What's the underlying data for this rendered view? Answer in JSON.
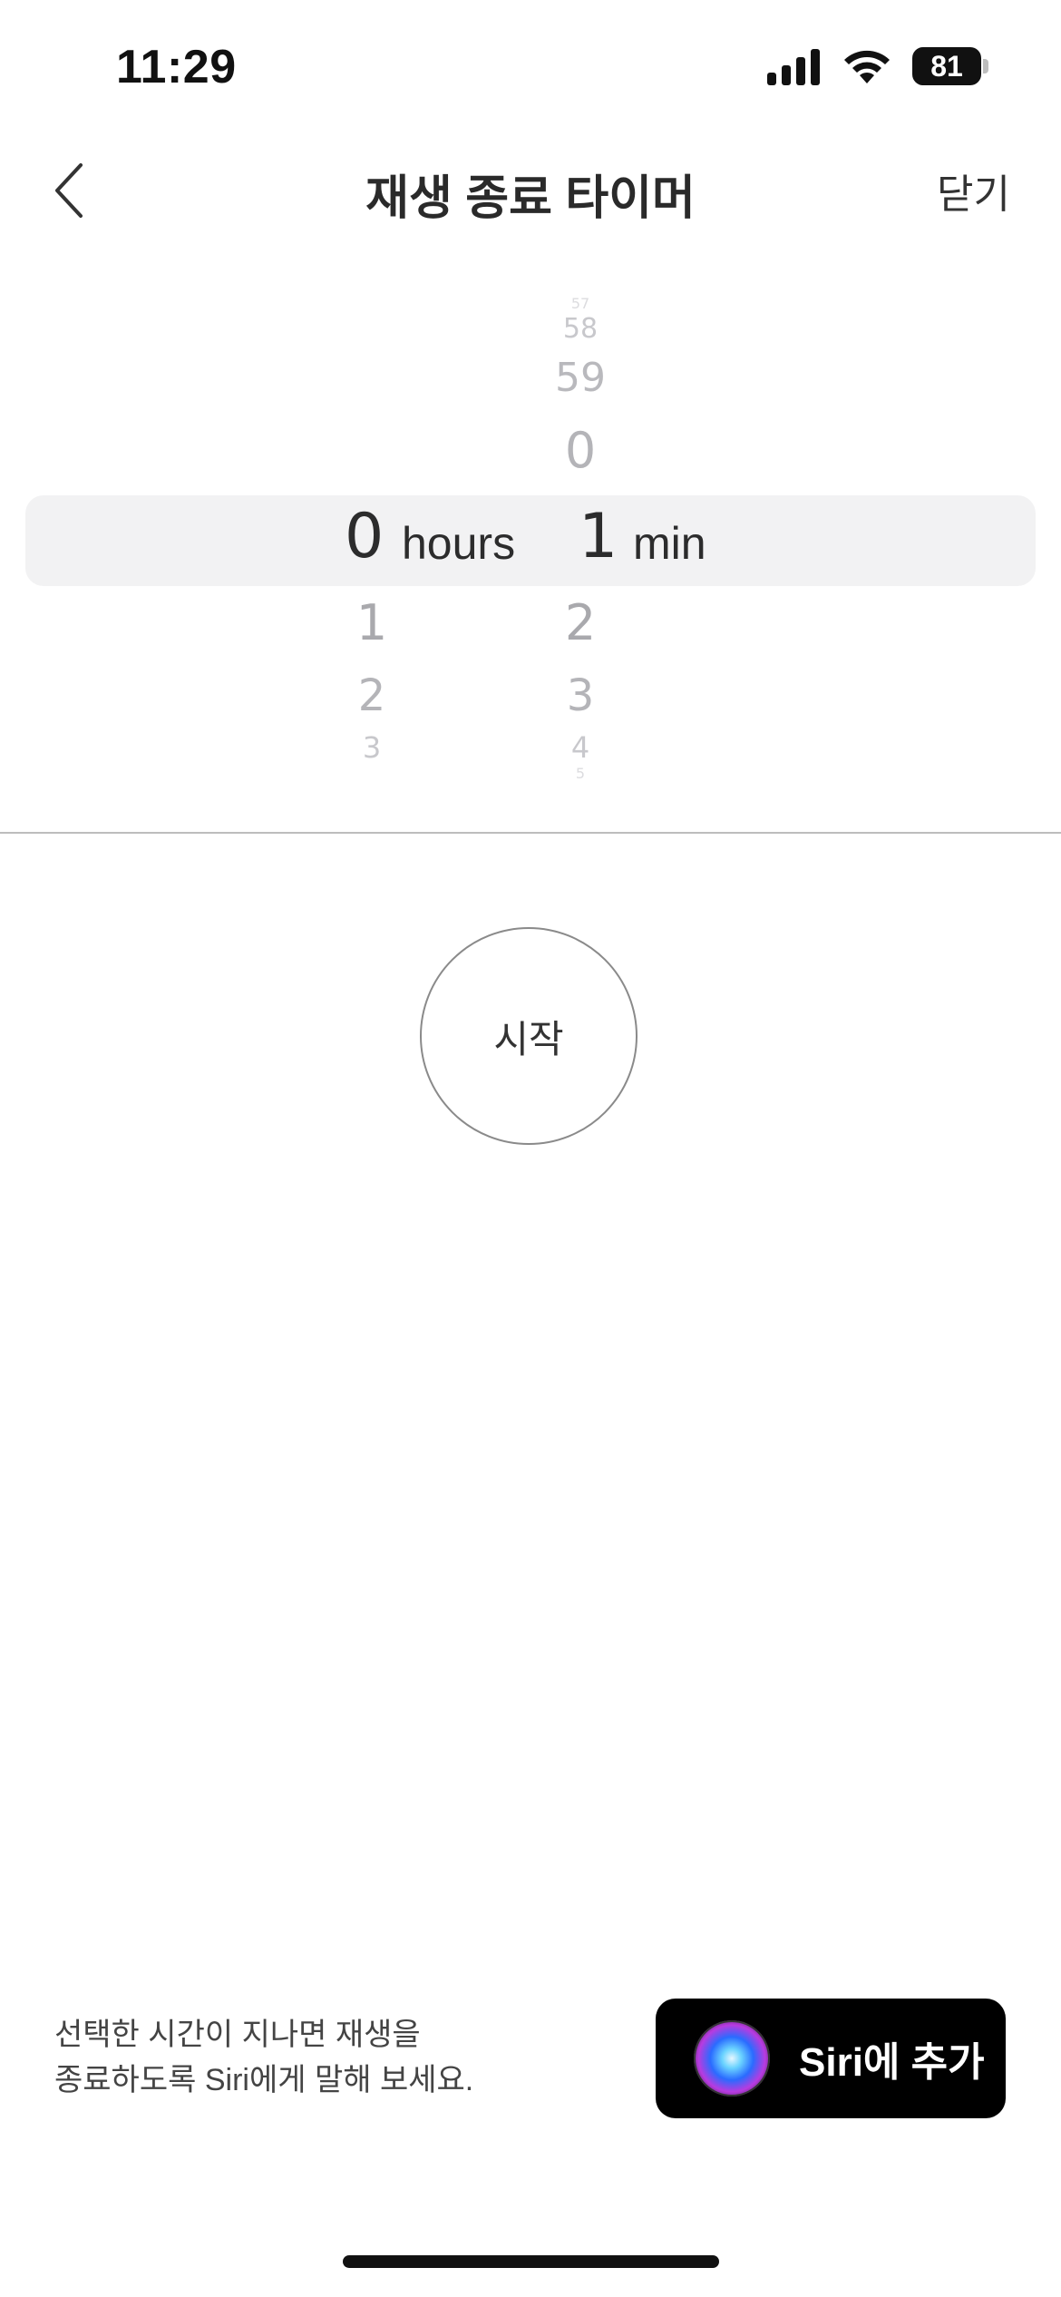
{
  "status_bar": {
    "time": "11:29",
    "battery": "81"
  },
  "nav": {
    "title": "재생 종료 타이머",
    "close_label": "닫기"
  },
  "picker": {
    "hours_above": [],
    "hours_selected": "0",
    "hours_unit": "hours",
    "hours_below": [
      "1",
      "2",
      "3"
    ],
    "minutes_above": [
      "57",
      "58",
      "59",
      "0"
    ],
    "minutes_selected": "1",
    "minutes_unit": "min",
    "minutes_below": [
      "2",
      "3",
      "4",
      "5"
    ]
  },
  "start_label": "시작",
  "siri": {
    "description_line1": "선택한 시간이 지나면 재생을",
    "description_line2": "종료하도록 Siri에게 말해 보세요.",
    "button_label": "Siri에 추가"
  },
  "colors": {
    "siri_button_bg": "#000000",
    "picker_highlight": "#f2f2f3"
  }
}
